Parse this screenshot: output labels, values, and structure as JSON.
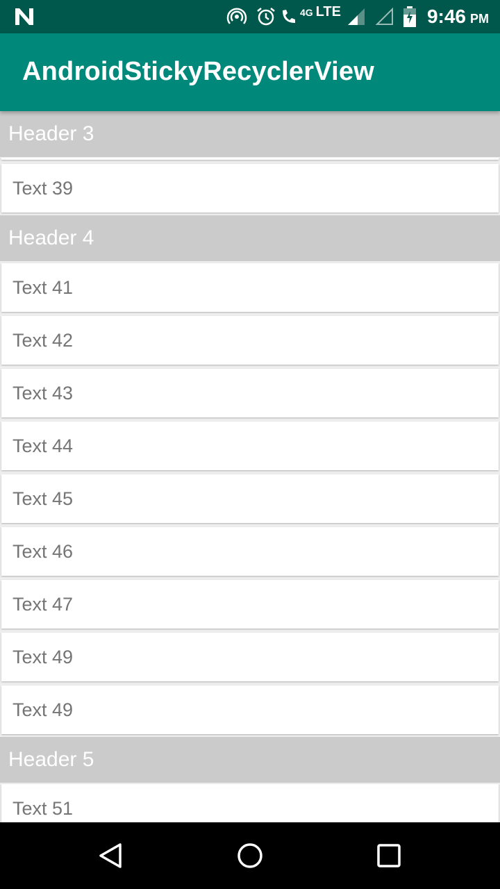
{
  "status_bar": {
    "icons": [
      "n-logo-icon",
      "hotspot-icon",
      "alarm-icon",
      "wifi-call-icon",
      "signal-icon",
      "signal-empty-icon",
      "battery-icon"
    ],
    "net_4g": "4G",
    "net_lte": "LTE",
    "time": "9:46",
    "ampm": "PM"
  },
  "app_bar": {
    "title": "AndroidStickyRecyclerView"
  },
  "list": {
    "header_3": "Header 3",
    "item_39": "Text 39",
    "header_4": "Header 4",
    "items_group_4": [
      "Text 41",
      "Text 42",
      "Text 43",
      "Text 44",
      "Text 45",
      "Text 46",
      "Text 47",
      "Text 49",
      "Text 49"
    ],
    "header_5": "Header 5",
    "item_51": "Text 51"
  },
  "nav_bar": {
    "icons": [
      "back-icon",
      "home-icon",
      "recents-icon"
    ]
  },
  "colors": {
    "status_bar": "#00574b",
    "app_bar": "#00897b",
    "header_bg": "#cbcbcb",
    "item_text": "#757575"
  }
}
